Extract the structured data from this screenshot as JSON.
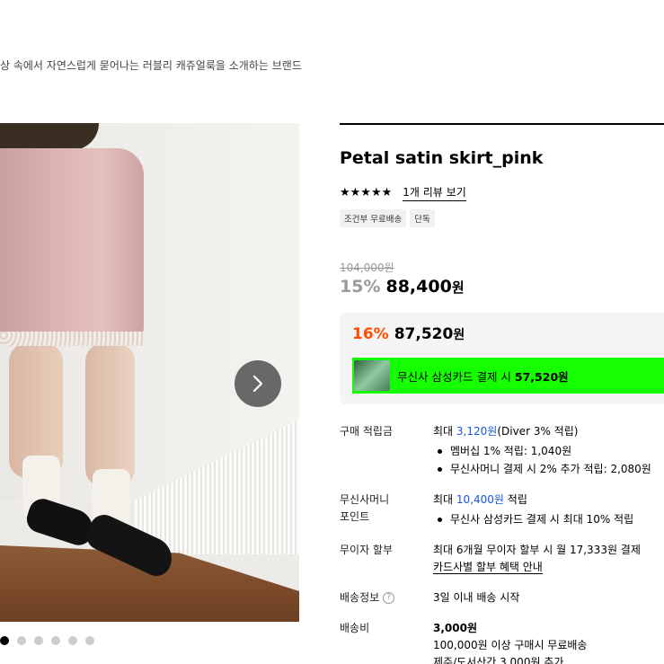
{
  "brand": {
    "tagline": "상 속에서 자연스럽게 묻어나는 러블리 캐쥬얼룩을 소개하는 브랜드"
  },
  "gallery": {
    "next_icon": "chevron-right-icon",
    "dot_count": 6,
    "active_index": 0
  },
  "product": {
    "title": "Petal satin skirt_pink",
    "stars": "★★★★★",
    "review_link": "1개 리뷰 보기",
    "tags": [
      "조건부 무료배송",
      "단독"
    ],
    "original_price": "104,000원",
    "discount": "15%",
    "price": "88,400",
    "currency": "원"
  },
  "member_price": {
    "discount": "16%",
    "price": "87,520",
    "currency": "원",
    "card_banner_prefix": "무신사 삼성카드 결제 시",
    "card_banner_price": "57,520원",
    "card_banner_color": "#16ff00"
  },
  "info": {
    "points": {
      "label": "구매 적립금",
      "prefix": "최대",
      "amount": "3,120원",
      "suffix": "(Diver 3% 적립)",
      "bullets": [
        "멤버십 1% 적립: 1,040원",
        "무신사머니 결제 시 2% 추가 적립: 2,080원"
      ]
    },
    "money_points": {
      "label_line1": "무신사머니",
      "label_line2": "포인트",
      "prefix": "최대",
      "amount": "10,400원",
      "suffix": "적립",
      "bullets": [
        "무신사 삼성카드 결제 시 최대 10% 적립"
      ]
    },
    "installment": {
      "label": "무이자 할부",
      "text": "최대 6개월 무이자 할부 시 월 17,333원 결제",
      "link": "카드사별 할부 혜택 안내"
    },
    "shipping_info": {
      "label": "배송정보",
      "help_icon": "question-circle-icon",
      "text": "3일 이내 배송 시작"
    },
    "shipping_fee": {
      "label": "배송비",
      "amount": "3,000원",
      "line2": "100,000원 이상 구매시 무료배송",
      "line3": "제주/도서산간 3,000원 추가"
    }
  },
  "colors": {
    "accent_orange": "#ff4d00",
    "link_blue": "#1a56db"
  }
}
